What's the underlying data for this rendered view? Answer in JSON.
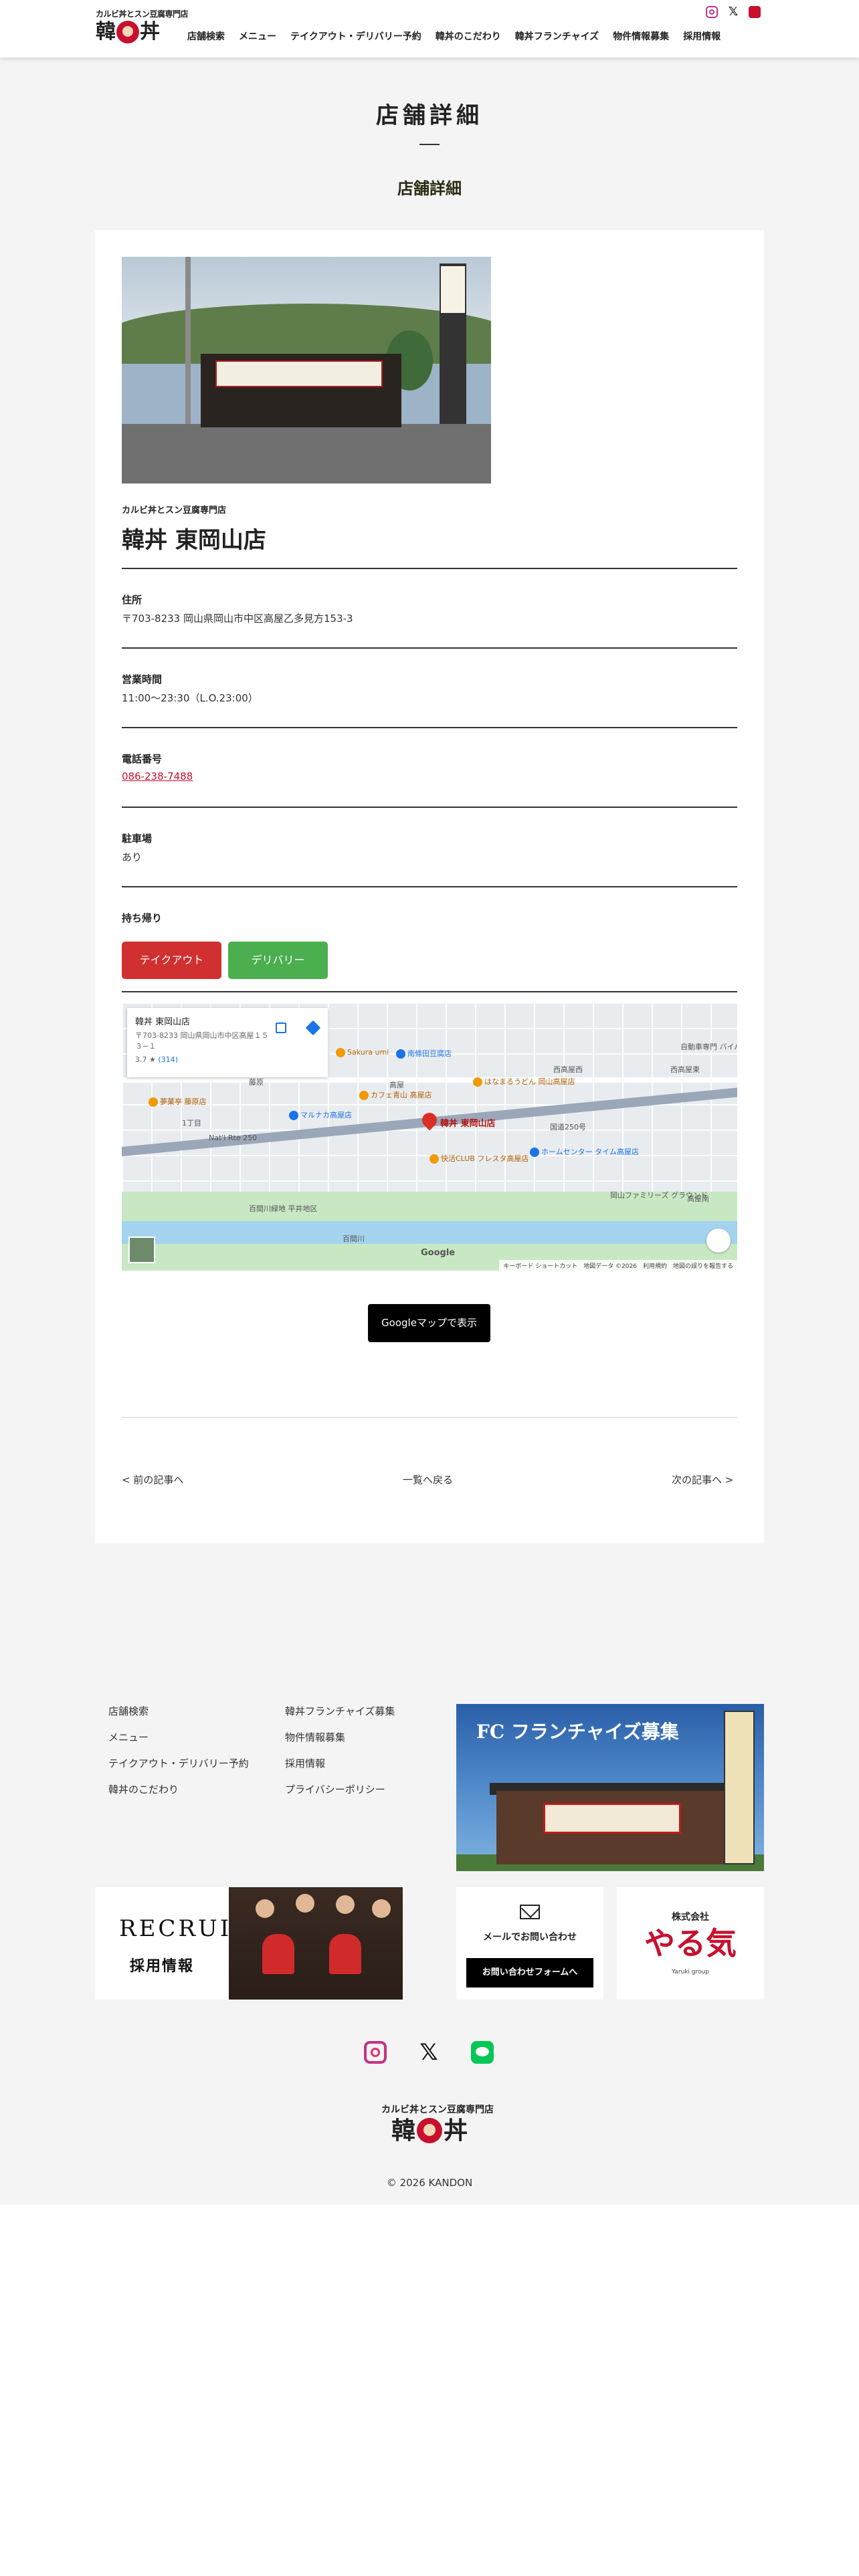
{
  "header": {
    "logo_tagline": "カルビ丼とスン豆腐専門店",
    "logo_text_left": "韓",
    "logo_text_right": "丼",
    "nav": [
      "店舗検索",
      "メニュー",
      "テイクアウト・デリバリー予約",
      "韓丼のこだわり",
      "韓丼フランチャイズ",
      "物件情報募集",
      "採用情報"
    ],
    "social_icons": [
      "instagram-icon",
      "x-icon",
      "line-icon"
    ]
  },
  "page": {
    "title": "店舗詳細",
    "subtitle": "店舗詳細"
  },
  "store": {
    "category": "カルビ丼とスン豆腐専門店",
    "name": "韓丼 東岡山店",
    "address_label": "住所",
    "address": "〒703-8233 岡山県岡山市中区高屋乙多見方153-3",
    "hours_label": "営業時間",
    "hours": "11:00〜23:30（L.O.23:00）",
    "tel_label": "電話番号",
    "tel": "086-238-7488",
    "parking_label": "駐車場",
    "parking": "あり",
    "takeout_label": "持ち帰り",
    "takeout_button": "テイクアウト",
    "delivery_button": "デリバリー",
    "takeout_color": "#d0302f",
    "delivery_color": "#4bae4f"
  },
  "map": {
    "card_name": "韓丼 東岡山店",
    "card_address": "〒703-8233 岡山県岡山市中区高屋１５３−１",
    "card_rating": "3.7",
    "card_reviews": "(314)",
    "pin_label": "韓丼 東岡山店",
    "labels": [
      "藤原",
      "1丁目",
      "高屋",
      "西高屋西",
      "西高屋東",
      "国道250号",
      "Nat'l Rte 250",
      "百間川",
      "高屋南",
      "百間川緑地 平井地区"
    ],
    "pois": [
      "Sakura umi",
      "南條田豆腐店",
      "カフェ青山 高屋店",
      "はなまるうどん 岡山高屋店",
      "夢菓亭 藤原店",
      "マルナカ高屋店",
      "快活CLUB フレスタ高屋店",
      "ホームセンター タイム高屋店",
      "自動車専門 バイパス 東岡山",
      "岡山ファミリーズ グラウンド"
    ],
    "brand": "Google",
    "attribution": "キーボード ショートカット　地図データ ©2026　利用規約　地図の誤りを報告する"
  },
  "actions": {
    "gmap_button": "Googleマップで表示",
    "prev": "< 前の記事へ",
    "list": "一覧へ戻る",
    "next": "次の記事へ >"
  },
  "footer": {
    "col1": [
      "店舗検索",
      "メニュー",
      "テイクアウト・デリバリー予約",
      "韓丼のこだわり"
    ],
    "col2": [
      "韓丼フランチャイズ募集",
      "物件情報募集",
      "採用情報",
      "プライバシーポリシー"
    ],
    "fc_banner": "フランチャイズ募集",
    "fc_mark": "FC",
    "recruit_en": "RECRUIT",
    "recruit_ja": "採用情報",
    "mail_title": "メールでお問い合わせ",
    "mail_button": "お問い合わせフォームへ",
    "company_prefix": "株式会社",
    "company_name": "やる気",
    "company_sub": "Yaruki group",
    "social_icons": [
      "instagram-icon",
      "x-icon",
      "line-icon"
    ],
    "logo_tagline": "カルビ丼とスン豆腐専門店",
    "logo_text_left": "韓",
    "logo_text_right": "丼",
    "copyright": "© 2026 KANDON"
  }
}
